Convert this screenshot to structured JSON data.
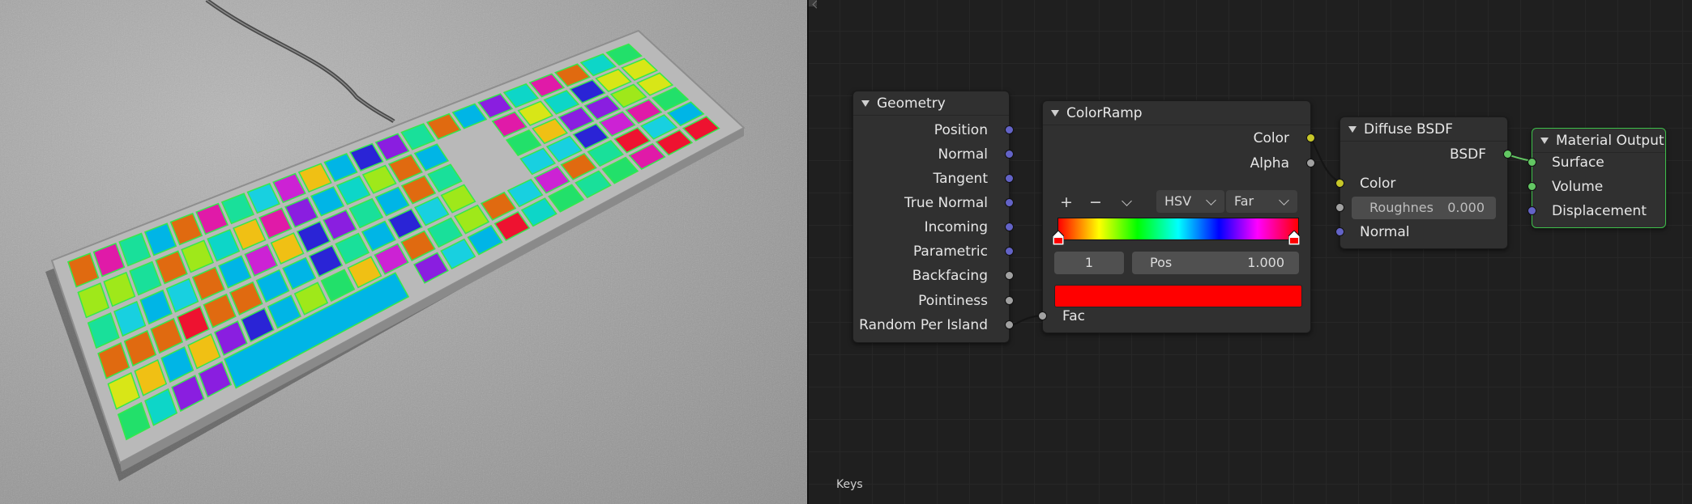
{
  "node_editor": {
    "frame_label": "Keys",
    "nodes": {
      "geometry": {
        "title": "Geometry",
        "outputs": [
          "Position",
          "Normal",
          "Tangent",
          "True Normal",
          "Incoming",
          "Parametric",
          "Backfacing",
          "Pointiness",
          "Random Per Island"
        ]
      },
      "colorramp": {
        "title": "ColorRamp",
        "outputs": [
          "Color",
          "Alpha"
        ],
        "add_label": "+",
        "remove_label": "−",
        "color_mode": "HSV",
        "interpolation": "Far",
        "stop_index": "1",
        "pos_label": "Pos",
        "pos_value": "1.000",
        "stop_color": "#ff0000",
        "input_fac": "Fac"
      },
      "diffuse": {
        "title": "Diffuse BSDF",
        "output": "BSDF",
        "inputs": {
          "color": "Color",
          "roughness_label": "Roughnes",
          "roughness_value": "0.000",
          "normal": "Normal"
        }
      },
      "material_output": {
        "title": "Material Output",
        "inputs": [
          "Surface",
          "Volume",
          "Displacement"
        ]
      }
    },
    "socket_colors": {
      "vector": "#6363c7",
      "float": "#a1a1a1",
      "color": "#c7c729",
      "shader": "#63c763"
    }
  }
}
